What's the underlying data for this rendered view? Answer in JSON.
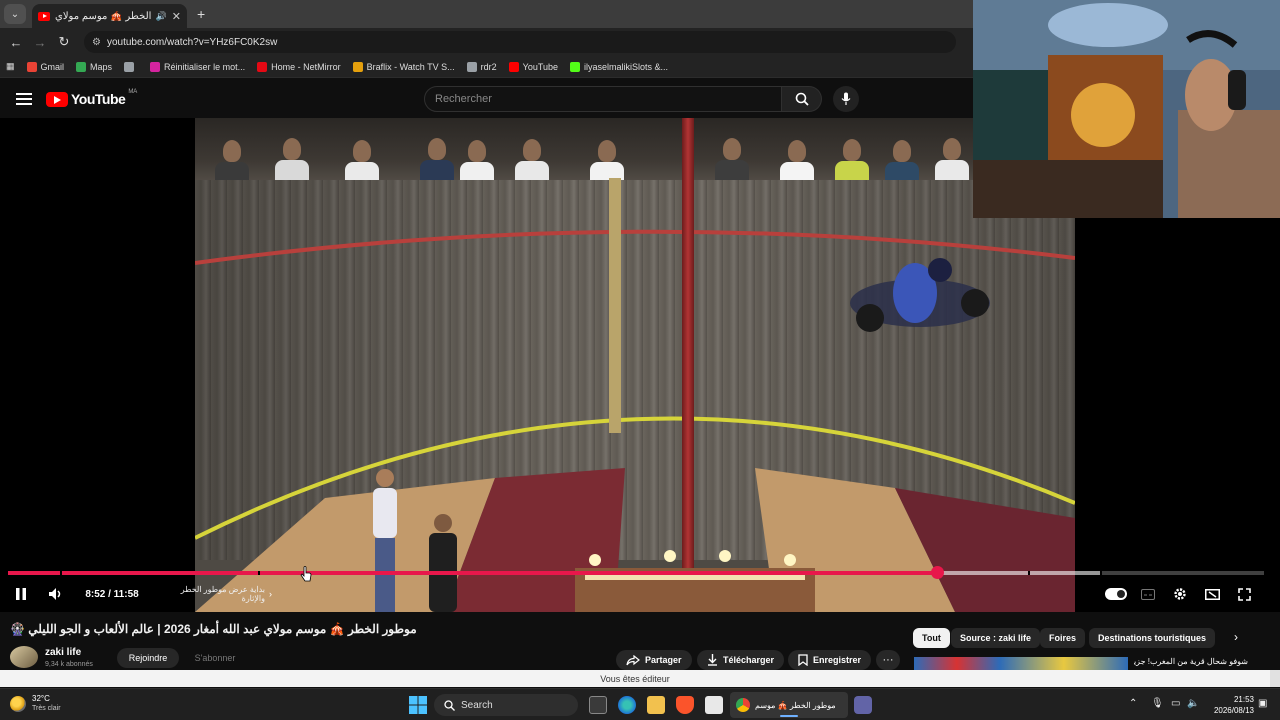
{
  "browser": {
    "tab": {
      "title": "موطور الخطر 🎪 موسم مولاي",
      "close": "✕"
    },
    "new_tab": "+",
    "url": "youtube.com/watch?v=YHz6FC0K2sw",
    "bookmarks": [
      {
        "label": "Gmail",
        "color": "#ea4335"
      },
      {
        "label": "Maps",
        "color": "#34a853"
      },
      {
        "label": "",
        "color": "#9aa0a6"
      },
      {
        "label": "Réinitialiser le mot...",
        "color": "#d6249f"
      },
      {
        "label": "Home - NetMirror",
        "color": "#e50914"
      },
      {
        "label": "Braflix - Watch TV S...",
        "color": "#e5a00d"
      },
      {
        "label": "rdr2",
        "color": "#9aa0a6"
      },
      {
        "label": "YouTube",
        "color": "#ff0000"
      },
      {
        "label": "ilyaselmalikiSlots &...",
        "color": "#53fc18"
      }
    ]
  },
  "youtube": {
    "logo_text": "YouTube",
    "country": "MA",
    "search_placeholder": "Rechercher"
  },
  "player": {
    "time": "8:52 / 11:58",
    "progress": 0.74,
    "buffered": 0.87,
    "chapter": "بداية عرض موطور الخطر والإثارة"
  },
  "video": {
    "title": "🎡 موطور الخطر 🎪 موسم مولاي عبد الله أمغار 2026 | عالم الألعاب و الجو الليلي",
    "channel": "zaki life",
    "subscribers": "9,34 k abonnés",
    "join": "Rejoindre",
    "subscribe": "S'abonner",
    "actions": {
      "share": "Partager",
      "download": "Télécharger",
      "save": "Enregistrer",
      "more": "···"
    }
  },
  "chips": [
    "Tout",
    "Source : zaki life",
    "Foires",
    "Destinations touristiques"
  ],
  "recommendation": {
    "title": "شوفو شحال قرية من المغرب! جزيرة"
  },
  "editor_notice": "Vous êtes éditeur",
  "taskbar": {
    "temperature": "32°C",
    "weather": "Très clair",
    "search": "Search",
    "active_window": "موطور الخطر 🎪 موسم",
    "time": "21:53",
    "date": "2026/08/13"
  }
}
